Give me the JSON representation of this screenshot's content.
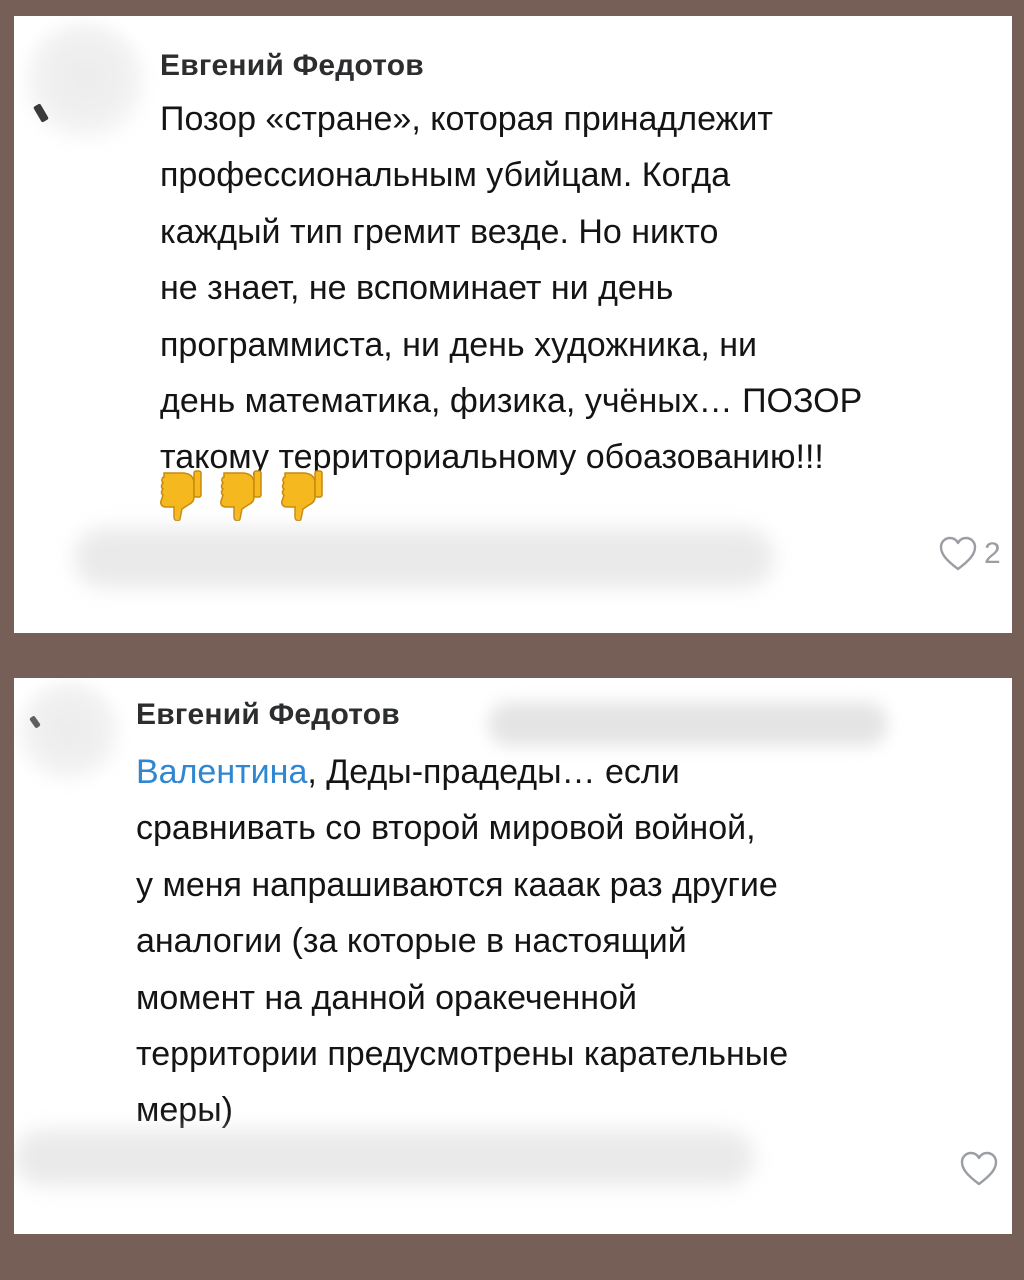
{
  "comments": [
    {
      "author": "Евгений Федотов",
      "mention": "",
      "lines": [
        "Позор «стране», которая принадлежит",
        "профессиональным убийцам. Когда",
        "каждый тип гремит везде. Но никто",
        "не знает, не вспоминает ни день",
        "программиста, ни день художника, ни",
        "день математика, физика, учёных… ПОЗОР",
        "такому территориальному обоазованию!!!"
      ],
      "reactions": [
        "thumbs-down-emoji",
        "thumbs-down-emoji",
        "thumbs-down-emoji"
      ],
      "likes": "2"
    },
    {
      "author": "Евгений Федотов",
      "mention": "Валентина",
      "lines": [
        ", Деды-прадеды… если",
        "сравнивать со второй мировой войной,",
        "у меня напрашиваются кааак раз другие",
        "аналогии (за которые в настоящий",
        "момент на данной оракеченной",
        "территории предусмотрены карательные",
        "меры)"
      ],
      "likes": ""
    }
  ],
  "icons": {
    "like": "heart-outline-icon",
    "avatar": "avatar-blurred"
  },
  "colors": {
    "background": "#765f57",
    "card": "#ffffff",
    "mention": "#2f86d1",
    "muted": "#9a9ea3",
    "text": "#141414"
  }
}
